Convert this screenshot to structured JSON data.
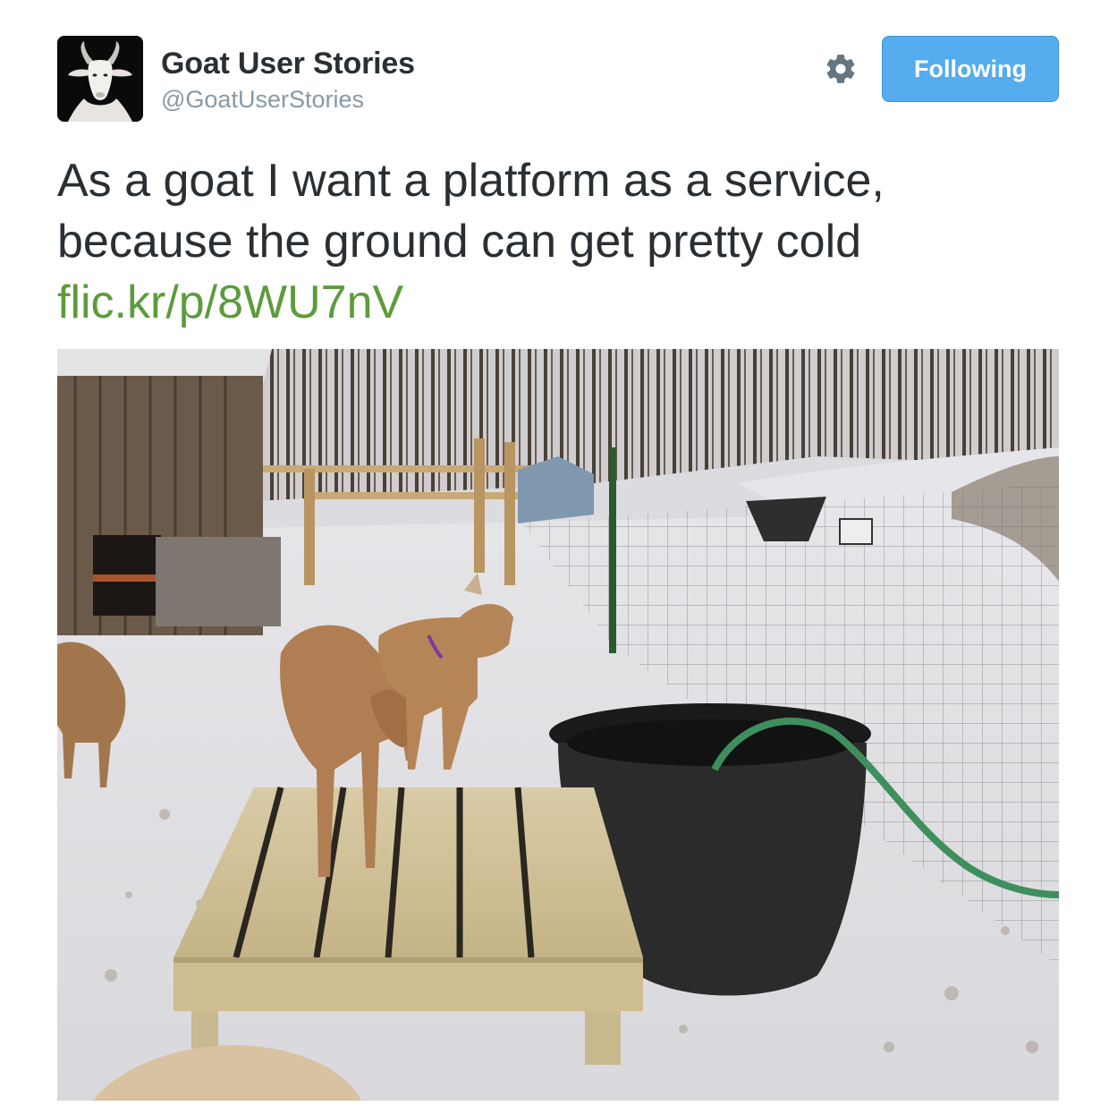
{
  "tweet": {
    "author": {
      "display_name": "Goat User Stories",
      "handle": "@GoatUserStories"
    },
    "actions": {
      "settings_icon": "gear-icon",
      "follow_label": "Following",
      "follow_color": "#55acee"
    },
    "text_line_1": "As a goat I want a platform as a service,",
    "text_line_2": "because the ground can get pretty cold",
    "link": "flic.kr/p/8WU7nV",
    "link_color": "#5d9b3c"
  }
}
